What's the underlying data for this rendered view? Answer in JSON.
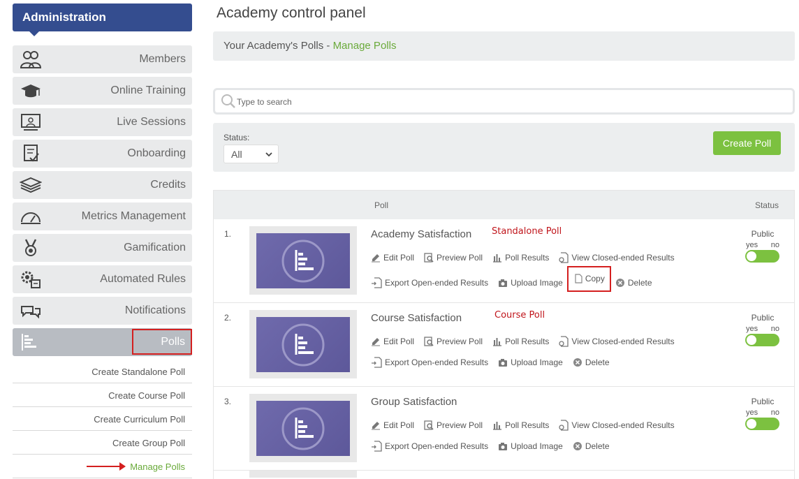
{
  "sidebar": {
    "header": "Administration",
    "items": [
      {
        "label": "Members",
        "icon": "members-icon"
      },
      {
        "label": "Online Training",
        "icon": "graduation-cap-icon"
      },
      {
        "label": "Live Sessions",
        "icon": "presentation-icon"
      },
      {
        "label": "Onboarding",
        "icon": "checklist-icon"
      },
      {
        "label": "Credits",
        "icon": "layers-icon"
      },
      {
        "label": "Metrics Management",
        "icon": "speedometer-icon"
      },
      {
        "label": "Gamification",
        "icon": "medal-icon"
      },
      {
        "label": "Automated Rules",
        "icon": "gears-icon"
      },
      {
        "label": "Notifications",
        "icon": "chat-bubbles-icon"
      },
      {
        "label": "Polls",
        "icon": "bar-chart-icon"
      }
    ],
    "subitems": [
      "Create Standalone Poll",
      "Create Course Poll",
      "Create Curriculum Poll",
      "Create Group Poll",
      "Manage Polls"
    ]
  },
  "main": {
    "title": "Academy control panel",
    "breadcrumb_prefix": "Your Academy's Polls - ",
    "breadcrumb_link": "Manage Polls",
    "search_placeholder": "Type to search",
    "status_label": "Status:",
    "status_value": "All",
    "create_button": "Create Poll",
    "col_poll": "Poll",
    "col_status": "Status"
  },
  "actions": {
    "edit": "Edit Poll",
    "preview": "Preview Poll",
    "results": "Poll Results",
    "closed": "View Closed-ended Results",
    "export": "Export Open-ended Results",
    "upload": "Upload Image",
    "copy": "Copy",
    "delete": "Delete"
  },
  "status_text": {
    "public": "Public",
    "yes": "yes",
    "no": "no"
  },
  "polls": [
    {
      "num": "1.",
      "title": "Academy Satisfaction",
      "tag": "Standalone Poll"
    },
    {
      "num": "2.",
      "title": "Course Satisfaction",
      "tag": "Course Poll"
    },
    {
      "num": "3.",
      "title": "Group Satisfaction",
      "tag": ""
    }
  ],
  "colors": {
    "brand": "#344d8f",
    "accent_green": "#7cc140",
    "highlight_red": "#d41f1f"
  }
}
